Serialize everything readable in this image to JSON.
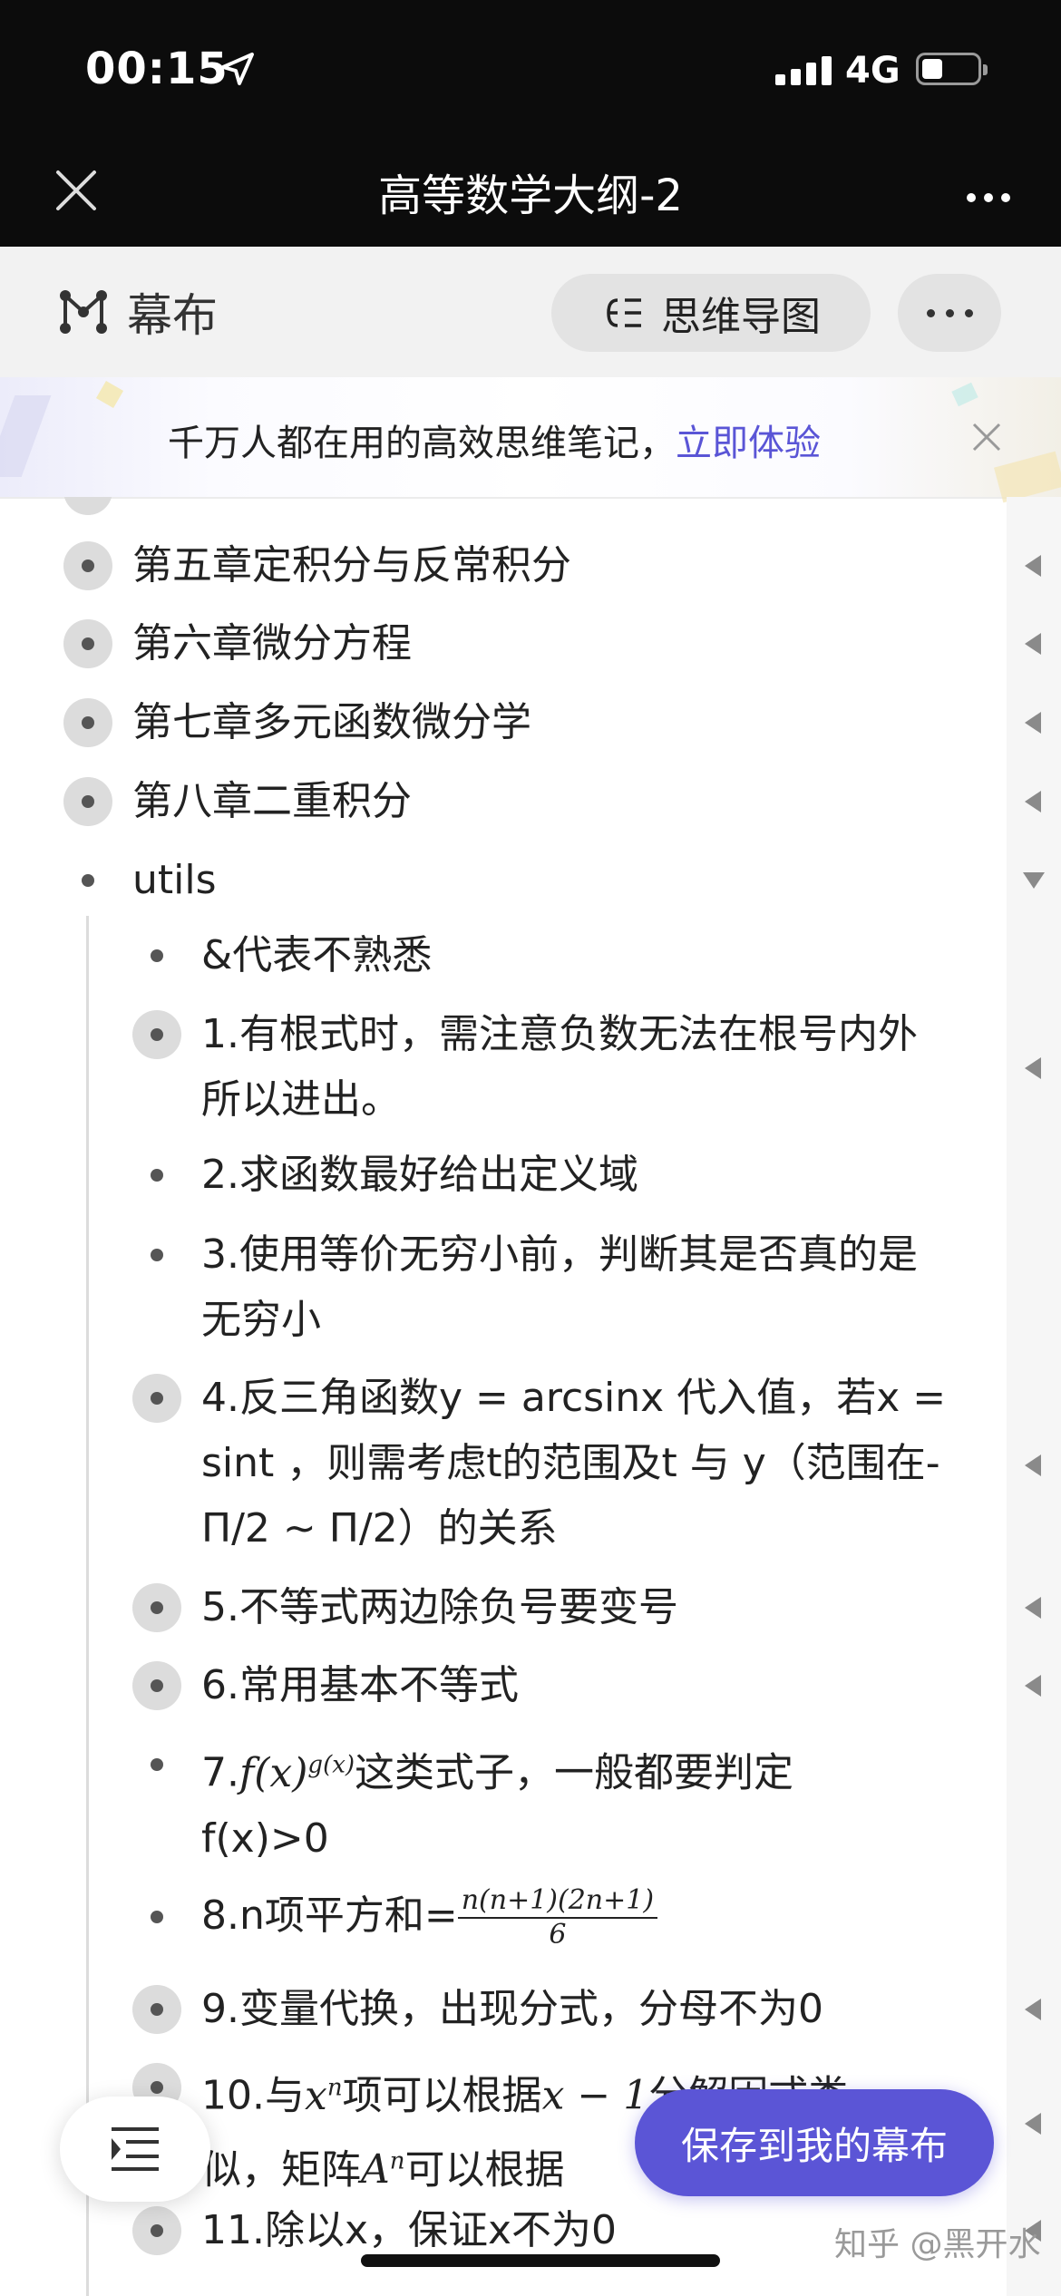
{
  "status": {
    "time": "00:15",
    "network": "4G"
  },
  "navbar": {
    "title": "高等数学大纲-2"
  },
  "app": {
    "brand": "幕布",
    "mindmap_label": "思维导图"
  },
  "promo": {
    "text": "千万人都在用的高效思维笔记，",
    "link": "立即体验"
  },
  "outline": {
    "chapters": [
      "第五章定积分与反常积分",
      "第六章微分方程",
      "第七章多元函数微分学",
      "第八章二重积分"
    ],
    "utils_label": "utils",
    "items": [
      "&代表不熟悉",
      "1.有根式时，需注意负数无法在根号内外所以进出。",
      "2.求函数最好给出定义域",
      "3.使用等价无穷小前，判断其是否真的是无穷小",
      "4.反三角函数y = arcsinx 代入值，若x = sint ，则需考虑t的范围及t 与 y（范围在-Π/2 ~ Π/2）的关系",
      "5.不等式两边除负号要变号",
      "6.常用基本不等式",
      "7.f(x)^g(x)这类式子，一般都要判定f(x)>0",
      "8.n项平方和=n(n+1)(2n+1)/6",
      "9.变量代换，出现分式，分母不为0",
      "10.与x^n项可以根据x − 1分解因式类似，矩阵A^n可以根据",
      "11.除以x，保证x不为0"
    ],
    "item_parts": {
      "i7_prefix": "7.",
      "i7_suffix": "这类式子，一般都要判定",
      "i7_line2": "f(x)>0",
      "i8_prefix": "8.n项平方和=",
      "i8_num": "n(n+1)(2n+1)",
      "i8_den": "6",
      "i10_line1a": "10.与",
      "i10_line1b": "项可以根据",
      "i10_line1c": "分解因式类",
      "i10_line2a": "似，矩阵",
      "i10_line2b": "可以根据"
    }
  },
  "actions": {
    "save_label": "保存到我的幕布"
  },
  "watermark": "知乎 @黑开水",
  "colors": {
    "accent": "#5b55d6",
    "dark_bar": "#0c0c0c",
    "header_bg": "#f2f2f2"
  }
}
